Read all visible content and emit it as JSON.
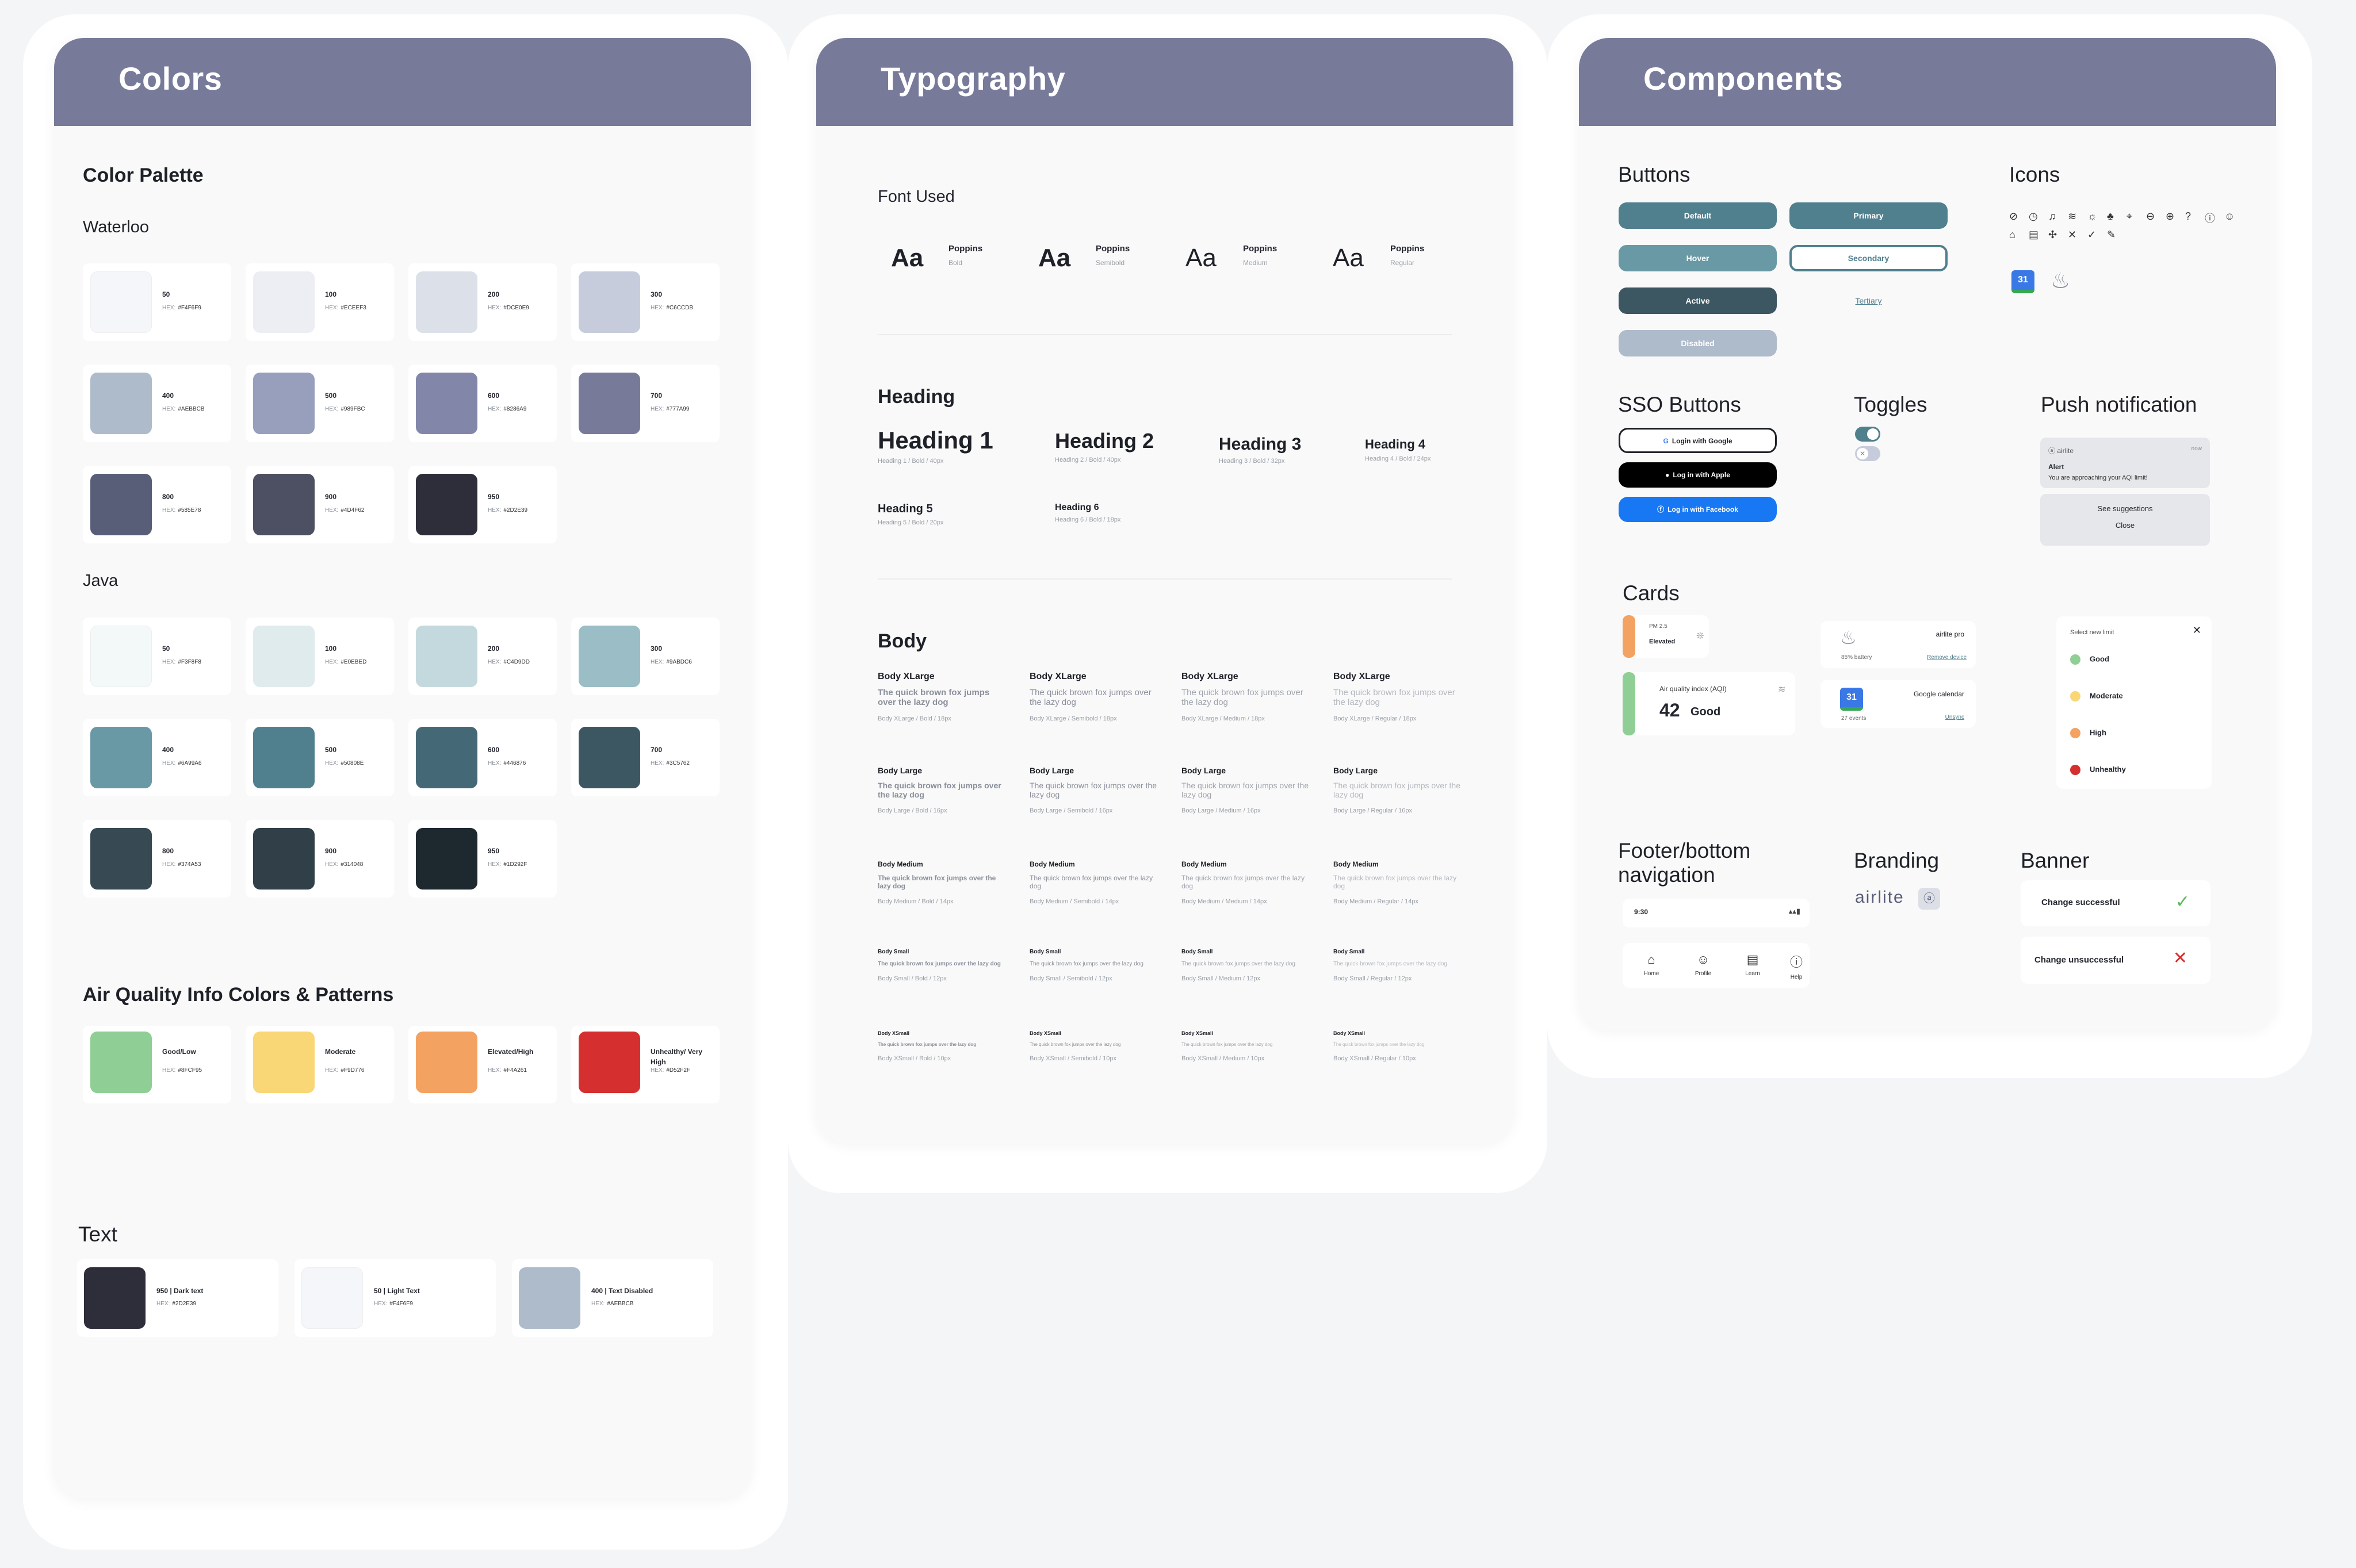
{
  "panels": {
    "colors": "Colors",
    "typography": "Typography",
    "components": "Components"
  },
  "colors": {
    "palette_title": "Color Palette",
    "waterloo": {
      "title": "Waterloo",
      "swatches": [
        {
          "n": "50",
          "hex": "#F4F6F9",
          "color": "#f4f6f9"
        },
        {
          "n": "100",
          "hex": "#ECEEF3",
          "color": "#eceef3"
        },
        {
          "n": "200",
          "hex": "#DCE0E9",
          "color": "#dce0e9"
        },
        {
          "n": "300",
          "hex": "#C6CCDB",
          "color": "#c6ccdb"
        },
        {
          "n": "400",
          "hex": "#AEBBCB",
          "color": "#aebbcb"
        },
        {
          "n": "500",
          "hex": "#989FBC",
          "color": "#989fbc"
        },
        {
          "n": "600",
          "hex": "#8286A9",
          "color": "#8286a9"
        },
        {
          "n": "700",
          "hex": "#777A99",
          "color": "#777a99"
        },
        {
          "n": "800",
          "hex": "#585E78",
          "color": "#585e78"
        },
        {
          "n": "900",
          "hex": "#4D4F62",
          "color": "#4d4f62"
        },
        {
          "n": "950",
          "hex": "#2D2E39",
          "color": "#2d2e39"
        }
      ]
    },
    "java": {
      "title": "Java",
      "swatches": [
        {
          "n": "50",
          "hex": "#F3F8F8",
          "color": "#f3f8f8"
        },
        {
          "n": "100",
          "hex": "#E0EBED",
          "color": "#e0ebed"
        },
        {
          "n": "200",
          "hex": "#C4D9DD",
          "color": "#c4d9dd"
        },
        {
          "n": "300",
          "hex": "#9ABDC6",
          "color": "#9abdc6"
        },
        {
          "n": "400",
          "hex": "#6A99A6",
          "color": "#6a99a6"
        },
        {
          "n": "500",
          "hex": "#50808E",
          "color": "#50808e"
        },
        {
          "n": "600",
          "hex": "#446876",
          "color": "#446876"
        },
        {
          "n": "700",
          "hex": "#3C5762",
          "color": "#3c5762"
        },
        {
          "n": "800",
          "hex": "#374A53",
          "color": "#374a53"
        },
        {
          "n": "900",
          "hex": "#314048",
          "color": "#314048"
        },
        {
          "n": "950",
          "hex": "#1D292F",
          "color": "#1d292f"
        }
      ]
    },
    "air_quality": {
      "title": "Air Quality Info Colors & Patterns",
      "items": [
        {
          "n": "Good/Low",
          "hex": "#8FCF95",
          "color": "#8fcf95"
        },
        {
          "n": "Moderate",
          "hex": "#F9D776",
          "color": "#f9d776"
        },
        {
          "n": "Elevated/High",
          "hex": "#F4A261",
          "color": "#f4a261"
        },
        {
          "n": "Unhealthy/ Very High",
          "hex": "#D52F2F",
          "color": "#d52f2f"
        }
      ]
    },
    "text": {
      "title": "Text",
      "items": [
        {
          "n": "950 | Dark text",
          "hex": "#2D2E39",
          "color": "#2d2e39"
        },
        {
          "n": "50 | Light Text",
          "hex": "#F4F6F9",
          "color": "#f4f6f9"
        },
        {
          "n": "400 | Text Disabled",
          "hex": "#AEBBCB",
          "color": "#aebbcb"
        }
      ]
    },
    "hex_label": "HEX:"
  },
  "typography": {
    "font_used": "Font Used",
    "fonts": [
      {
        "aa": "Aa",
        "name": "Poppins",
        "weight": "Bold"
      },
      {
        "aa": "Aa",
        "name": "Poppins",
        "weight": "Semibold"
      },
      {
        "aa": "Aa",
        "name": "Poppins",
        "weight": "Medium"
      },
      {
        "aa": "Aa",
        "name": "Poppins",
        "weight": "Regular"
      }
    ],
    "heading_title": "Heading",
    "headings": [
      {
        "t": "Heading 1",
        "m": "Heading 1 / Bold / 40px"
      },
      {
        "t": "Heading 2",
        "m": "Heading 2 / Bold / 40px"
      },
      {
        "t": "Heading 3",
        "m": "Heading 3 / Bold / 32px"
      },
      {
        "t": "Heading 4",
        "m": "Heading 4 / Bold / 24px"
      },
      {
        "t": "Heading 5",
        "m": "Heading 5 / Bold / 20px"
      },
      {
        "t": "Heading 6",
        "m": "Heading 6 / Bold / 18px"
      }
    ],
    "body_title": "Body",
    "sample": "The quick brown fox jumps over the lazy dog",
    "body_rows": [
      {
        "t": "Body XLarge",
        "m": [
          "Body XLarge / Bold / 18px",
          "Body XLarge / Semibold / 18px",
          "Body XLarge / Medium / 18px",
          "Body XLarge / Regular / 18px"
        ]
      },
      {
        "t": "Body Large",
        "m": [
          "Body Large / Bold / 16px",
          "Body Large / Semibold / 16px",
          "Body Large / Medium / 16px",
          "Body Large / Regular / 16px"
        ]
      },
      {
        "t": "Body Medium",
        "m": [
          "Body Medium / Bold / 14px",
          "Body Medium / Semibold / 14px",
          "Body Medium / Medium / 14px",
          "Body Medium / Regular / 14px"
        ]
      },
      {
        "t": "Body Small",
        "m": [
          "Body Small / Bold / 12px",
          "Body Small / Semibold / 12px",
          "Body Small / Medium / 12px",
          "Body Small / Regular / 12px"
        ]
      },
      {
        "t": "Body XSmall",
        "m": [
          "Body XSmall / Bold / 10px",
          "Body XSmall / Semibold / 10px",
          "Body XSmall / Medium / 10px",
          "Body XSmall / Regular / 10px"
        ]
      }
    ]
  },
  "components": {
    "buttons_title": "Buttons",
    "buttons": {
      "default": "Default",
      "primary": "Primary",
      "hover": "Hover",
      "secondary": "Secondary",
      "active": "Active",
      "tertiary": "Tertiary",
      "disabled": "Disabled"
    },
    "icons_title": "Icons",
    "sso_title": "SSO Buttons",
    "sso": {
      "google": "Login with Google",
      "apple": "Log in with Apple",
      "facebook": "Log in with Facebook"
    },
    "toggles_title": "Toggles",
    "push_title": "Push notification",
    "push": {
      "app": "airlite",
      "time": "now",
      "alert": "Alert",
      "message": "You are approaching your AQI limit!",
      "suggest": "See suggestions",
      "close": "Close"
    },
    "cards_title": "Cards",
    "cards": {
      "pm": "PM 2.5",
      "elevated": "Elevated",
      "aqi_label": "Air quality index (AQI)",
      "aqi_value": "42",
      "aqi_status": "Good",
      "device": "airlite pro",
      "battery": "85% battery",
      "remove": "Remove device",
      "calendar": "Google calendar",
      "events": "27 events",
      "unsync": "Unsync",
      "limit_title": "Select new limit",
      "limits": [
        {
          "n": "Good",
          "color": "#8fcf95"
        },
        {
          "n": "Moderate",
          "color": "#f9d776"
        },
        {
          "n": "High",
          "color": "#f4a261"
        },
        {
          "n": "Unhealthy",
          "color": "#d52f2f"
        }
      ]
    },
    "footer_title": "Footer/bottom navigation",
    "footer": {
      "time": "9:30",
      "tabs": [
        "Home",
        "Profile",
        "Learn",
        "Help"
      ]
    },
    "branding_title": "Branding",
    "brand": "airlite",
    "banner_title": "Banner",
    "banner": {
      "success": "Change successful",
      "fail": "Change unsuccessful"
    }
  }
}
